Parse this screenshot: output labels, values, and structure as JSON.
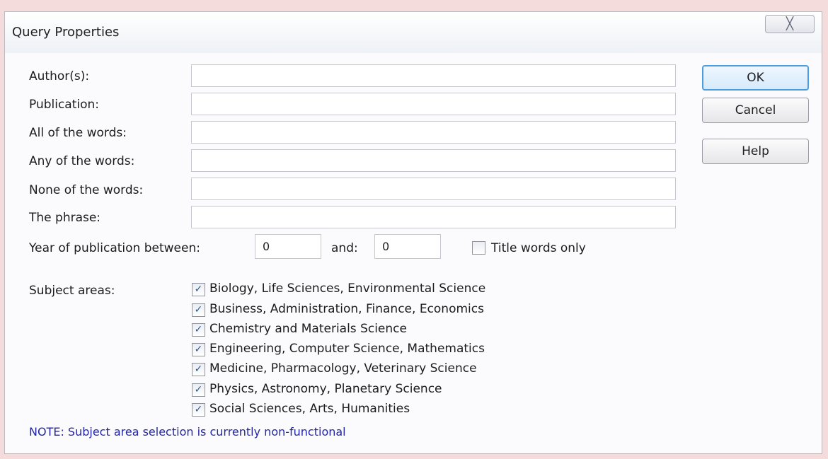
{
  "dialog": {
    "title": "Query Properties",
    "close_glyph": "╳"
  },
  "fields": [
    {
      "label": "Author(s):",
      "value": ""
    },
    {
      "label": "Publication:",
      "value": ""
    },
    {
      "label": "All of the words:",
      "value": ""
    },
    {
      "label": "Any of the words:",
      "value": ""
    },
    {
      "label": "None of the words:",
      "value": ""
    },
    {
      "label": "The phrase:",
      "value": ""
    }
  ],
  "year": {
    "label": "Year of publication between:",
    "from": "0",
    "and_label": "and:",
    "to": "0"
  },
  "title_words_only": {
    "label": "Title words only",
    "checked": false
  },
  "buttons": {
    "ok": "OK",
    "cancel": "Cancel",
    "help": "Help"
  },
  "subjects": {
    "label": "Subject areas:",
    "items": [
      {
        "label": "Biology, Life Sciences, Environmental Science",
        "checked": true
      },
      {
        "label": "Business, Administration, Finance, Economics",
        "checked": true
      },
      {
        "label": "Chemistry and Materials Science",
        "checked": true
      },
      {
        "label": "Engineering, Computer Science, Mathematics",
        "checked": true
      },
      {
        "label": "Medicine, Pharmacology, Veterinary Science",
        "checked": true
      },
      {
        "label": "Physics, Astronomy, Planetary Science",
        "checked": true
      },
      {
        "label": "Social Sciences, Arts, Humanities",
        "checked": true
      }
    ]
  },
  "note": "NOTE: Subject area selection is currently non-functional",
  "colors": {
    "note_text": "#2326a4",
    "default_button_border": "#4a9de0",
    "check_mark": "#2b5a93"
  }
}
